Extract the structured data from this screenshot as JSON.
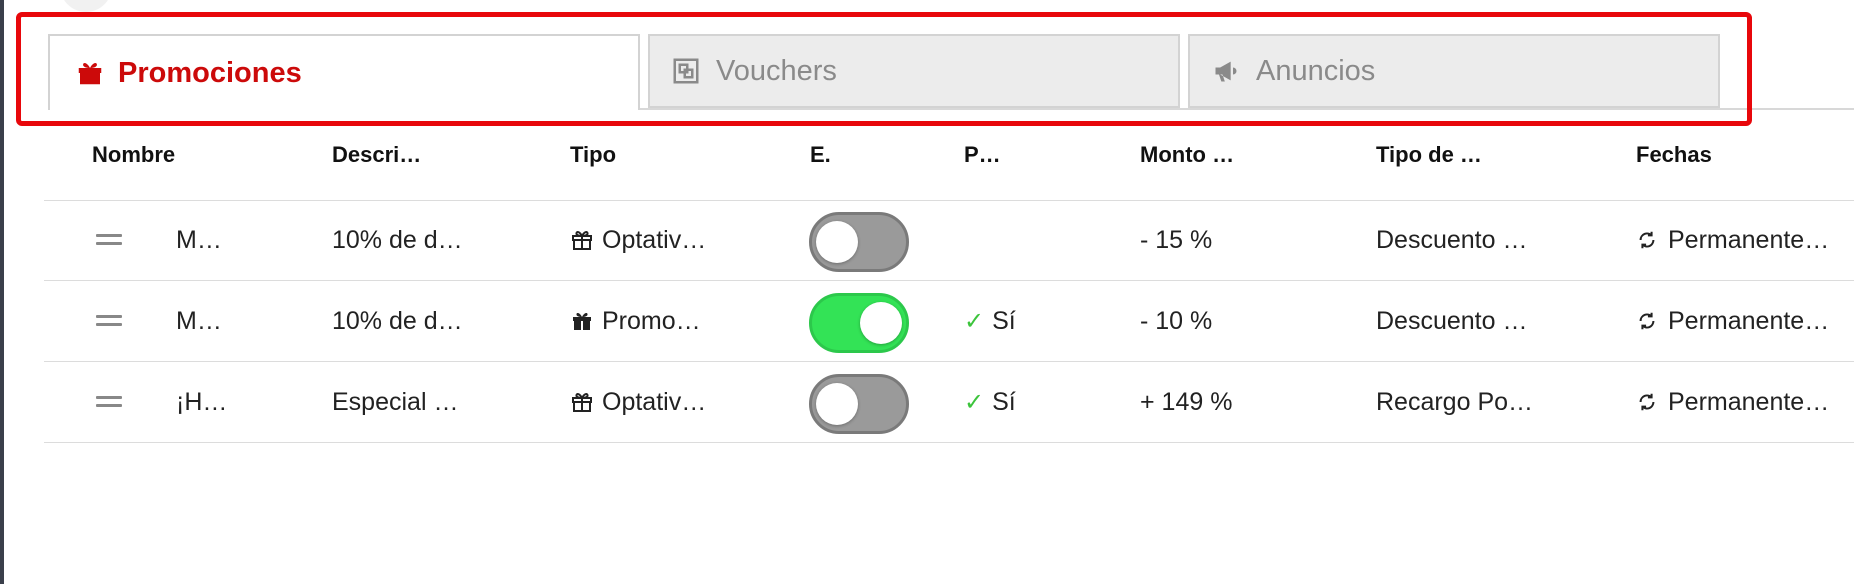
{
  "tabs": [
    {
      "label": "Promociones",
      "icon": "gift-icon",
      "active": true
    },
    {
      "label": "Vouchers",
      "icon": "voucher-icon",
      "active": false
    },
    {
      "label": "Anuncios",
      "icon": "megaphone-icon",
      "active": false
    }
  ],
  "colors": {
    "accent": "#cc0a0a",
    "highlight": "#e8070b",
    "toggle_on": "#33e356",
    "check": "#3cc43c"
  },
  "table": {
    "headers": [
      "Nombre",
      "Descri…",
      "Tipo",
      "E.",
      "P…",
      "Monto …",
      "Tipo de …",
      "Fechas"
    ],
    "rows": [
      {
        "nombre": "M…",
        "descripcion": "10% de d…",
        "tipo": "Optativ…",
        "enabled": false,
        "p": "",
        "monto": "- 15 %",
        "tipo_de": "Descuento …",
        "fechas": "Permanente…"
      },
      {
        "nombre": "M…",
        "descripcion": "10% de d…",
        "tipo": "Promo…",
        "enabled": true,
        "p": "Sí",
        "monto": "- 10 %",
        "tipo_de": "Descuento …",
        "fechas": "Permanente…"
      },
      {
        "nombre": "¡H…",
        "descripcion": "Especial …",
        "tipo": "Optativ…",
        "enabled": false,
        "p": "Sí",
        "monto": "+ 149 %",
        "tipo_de": "Recargo Po…",
        "fechas": "Permanente…"
      }
    ]
  }
}
